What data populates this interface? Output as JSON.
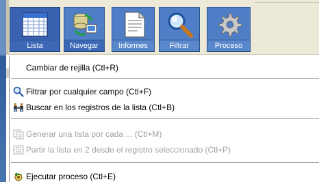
{
  "toolbar": {
    "buttons": [
      {
        "label": "Lista",
        "icon": "grid-list-icon"
      },
      {
        "label": "Navegar",
        "icon": "database-navigate-icon"
      },
      {
        "label": "Informes",
        "icon": "report-document-icon"
      },
      {
        "label": "Filtrar",
        "icon": "magnifier-icon"
      },
      {
        "label": "Proceso",
        "icon": "gear-process-icon"
      }
    ]
  },
  "menu": {
    "items": [
      {
        "label": "Cambiar de rejilla (Ctl+R)",
        "enabled": true,
        "icon": ""
      },
      {
        "label": "Filtrar por cualquier campo (Ctl+F)",
        "enabled": true,
        "icon": "magnifier-icon"
      },
      {
        "label": "Buscar en los registros de la lista (Ctl+B)",
        "enabled": true,
        "icon": "binoculars-icon"
      },
      {
        "label": "Generar una lista por cada ... (Ctl+M)",
        "enabled": false,
        "icon": "list-generate-icon"
      },
      {
        "label": "Partir la lista en 2 desde el registro seleccionado (Ctl+P)",
        "enabled": false,
        "icon": "split-list-icon"
      },
      {
        "label": "Ejecutar proceso (Ctl+E)",
        "enabled": true,
        "icon": "run-process-icon"
      }
    ]
  },
  "colors": {
    "toolbar_bg": "#ece9d8",
    "button_blue": "#4f7ec7",
    "disabled_text": "#a0a0a0"
  }
}
